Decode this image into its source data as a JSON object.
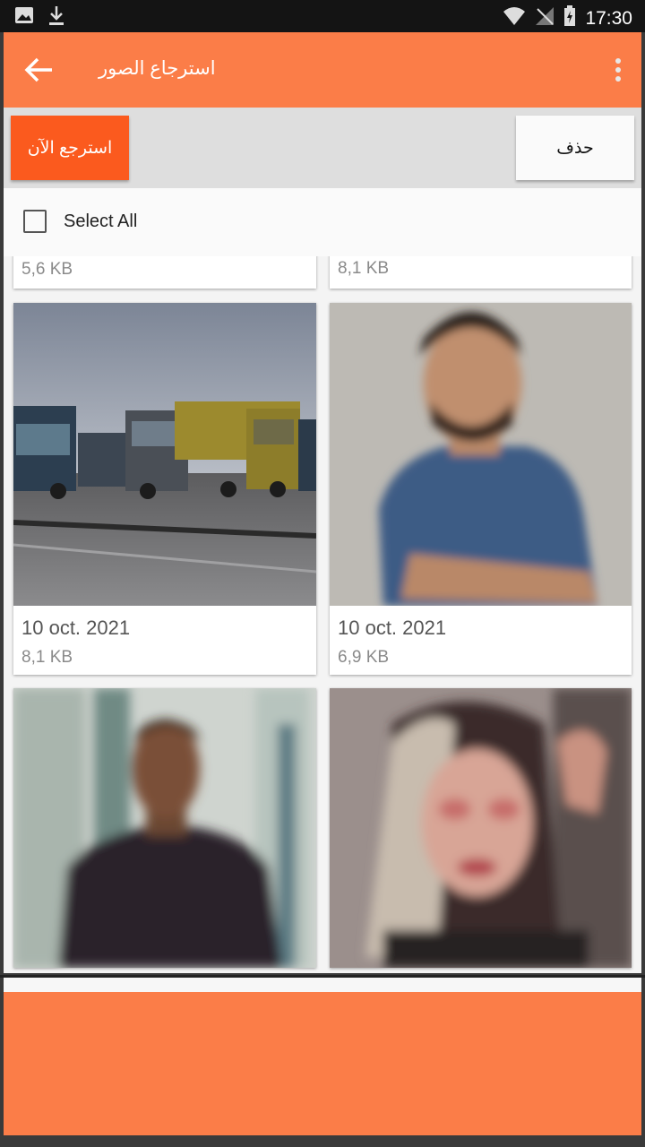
{
  "status_bar": {
    "time": "17:30",
    "left_icons": [
      "image-icon",
      "download-icon"
    ],
    "right_icons": [
      "wifi-icon",
      "no-signal-icon",
      "battery-icon"
    ]
  },
  "app_bar": {
    "title": "استرجاع الصور",
    "back_icon": "arrow-left-icon",
    "menu_icon": "more-vertical-icon",
    "color": "#fb7d48"
  },
  "actions": {
    "restore_label": "استرجع الآن",
    "delete_label": "حذف",
    "restore_color": "#fb5a1e"
  },
  "select_all": {
    "label": "Select All",
    "checked": false
  },
  "photos": [
    {
      "date": "",
      "size": "5,6 KB"
    },
    {
      "date": "",
      "size": "8,1 KB"
    },
    {
      "date": "10 oct. 2021",
      "size": "8,1 KB"
    },
    {
      "date": "10 oct. 2021",
      "size": "6,9 KB"
    },
    {
      "date": "",
      "size": ""
    },
    {
      "date": "",
      "size": ""
    }
  ],
  "footer": {
    "color": "#fb7d48"
  }
}
